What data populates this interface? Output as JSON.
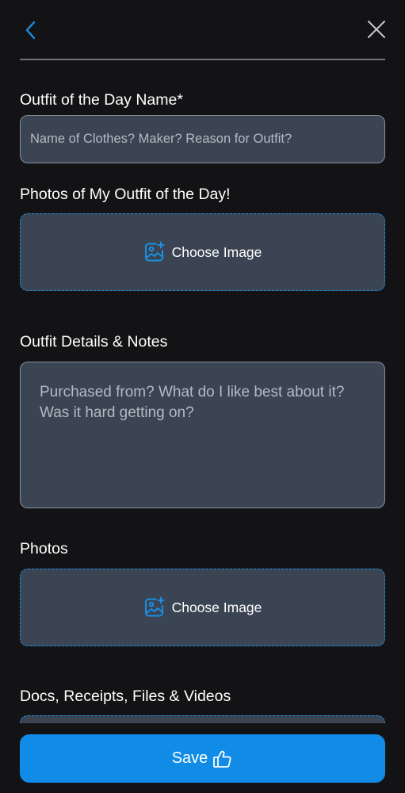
{
  "header": {
    "back_icon": "chevron-left-icon",
    "close_icon": "close-icon"
  },
  "form": {
    "name_field": {
      "label": "Outfit of the Day Name*",
      "placeholder": "Name of Clothes? Maker? Reason for Outfit?"
    },
    "outfit_photos": {
      "label": "Photos of My Outfit of the Day!",
      "button_label": "Choose Image",
      "icon": "add-image-icon"
    },
    "details": {
      "label": "Outfit Details & Notes",
      "placeholder": "Purchased from? What do I like best about it? Was it hard getting on?"
    },
    "photos": {
      "label": "Photos",
      "button_label": "Choose Image",
      "icon": "add-image-icon"
    },
    "docs": {
      "label": "Docs, Receipts, Files & Videos"
    }
  },
  "footer": {
    "save_label": "Save",
    "save_icon": "thumbs-up-icon"
  },
  "colors": {
    "background": "#131315",
    "field_bg": "#3a4453",
    "accent": "#108ce6",
    "dashed_border": "#1a8fe3"
  }
}
